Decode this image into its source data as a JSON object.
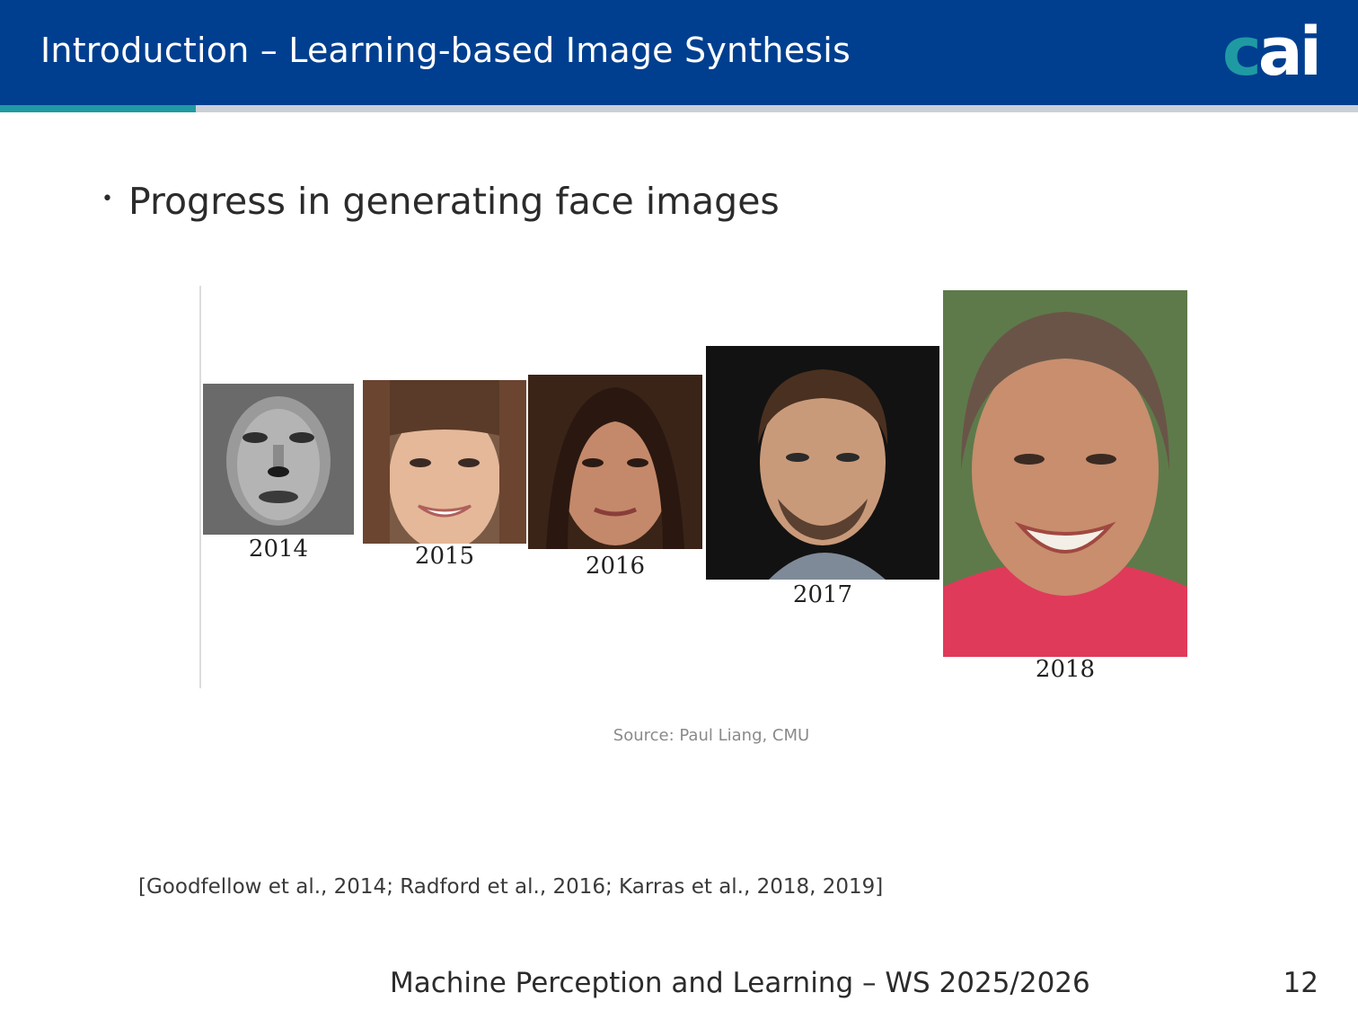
{
  "header": {
    "title": "Introduction – Learning-based Image Synthesis"
  },
  "logo": {
    "part1": "c",
    "part2": "ai"
  },
  "colors": {
    "header_bg": "#003f8f",
    "accent": "#1f9aa3",
    "stripe_gray": "#c9d0d8"
  },
  "content": {
    "bullet": "Progress in generating face images",
    "faces": [
      {
        "year": "2014",
        "icon": "face-2014-image"
      },
      {
        "year": "2015",
        "icon": "face-2015-image"
      },
      {
        "year": "2016",
        "icon": "face-2016-image"
      },
      {
        "year": "2017",
        "icon": "face-2017-image"
      },
      {
        "year": "2018",
        "icon": "face-2018-image"
      }
    ],
    "source": "Source: Paul Liang, CMU",
    "citation": "[Goodfellow et al., 2014; Radford et al., 2016; Karras et al., 2018, 2019]"
  },
  "footer": {
    "course": "Machine Perception and Learning – WS 2025/2026",
    "page": "12"
  }
}
